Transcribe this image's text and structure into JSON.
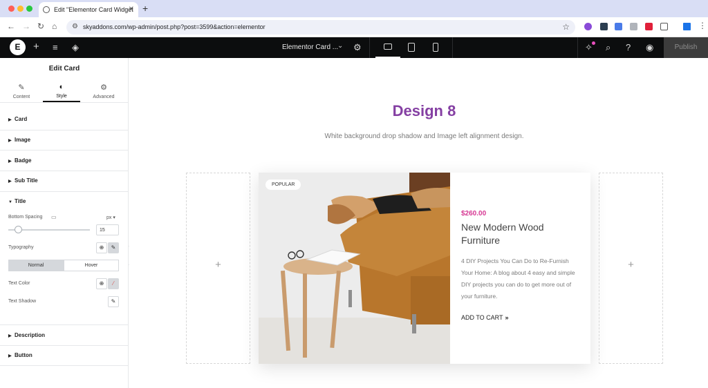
{
  "browser": {
    "tab_title": "Edit \"Elementor Card Widget",
    "url": "skyaddons.com/wp-admin/post.php?post=3599&action=elementor"
  },
  "topbar": {
    "doc_title": "Elementor Card ...",
    "publish_label": "Publish"
  },
  "panel": {
    "title": "Edit Card",
    "tabs": [
      {
        "label": "Content"
      },
      {
        "label": "Style"
      },
      {
        "label": "Advanced"
      }
    ],
    "sections": {
      "card": "Card",
      "image": "Image",
      "badge": "Badge",
      "subtitle": "Sub Title",
      "title": "Title",
      "description": "Description",
      "button": "Button"
    },
    "title_controls": {
      "bottom_spacing_label": "Bottom Spacing",
      "bottom_spacing_unit": "px",
      "bottom_spacing_value": "15",
      "bottom_spacing_fraction": 0.12,
      "typography_label": "Typography",
      "normal_label": "Normal",
      "hover_label": "Hover",
      "text_color_label": "Text Color",
      "text_shadow_label": "Text Shadow"
    }
  },
  "canvas": {
    "heading": "Design 8",
    "subheading": "White background drop shadow and Image left alignment design.",
    "heading_color": "#8540a3",
    "card": {
      "badge": "POPULAR",
      "price": "$260.00",
      "title": "New Modern Wood Furniture",
      "description": "4 DIY Projects You Can Do to Re-Furnish Your Home: A blog about 4 easy and simple DIY projects you can do to get more out of your furniture.",
      "button": "ADD TO CART",
      "price_color": "#d63893"
    }
  }
}
